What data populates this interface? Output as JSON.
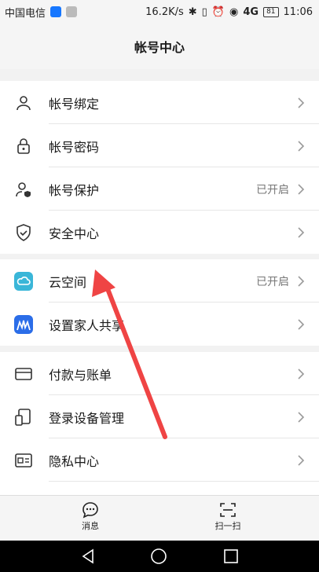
{
  "statusbar": {
    "carrier": "中国电信",
    "speed": "16.2K/s",
    "network": "4G",
    "battery": "81",
    "time": "11:06"
  },
  "header": {
    "title": "帐号中心"
  },
  "section1": [
    {
      "label": "帐号绑定",
      "status": ""
    },
    {
      "label": "帐号密码",
      "status": ""
    },
    {
      "label": "帐号保护",
      "status": "已开启"
    },
    {
      "label": "安全中心",
      "status": ""
    }
  ],
  "section2": [
    {
      "label": "云空间",
      "status": "已开启"
    },
    {
      "label": "设置家人共享",
      "status": ""
    }
  ],
  "section3": [
    {
      "label": "付款与账单",
      "status": ""
    },
    {
      "label": "登录设备管理",
      "status": ""
    },
    {
      "label": "隐私中心",
      "status": ""
    }
  ],
  "bottom_nav": {
    "messages": "消息",
    "scan": "扫一扫"
  },
  "colors": {
    "accent": "#3ab6d8",
    "arrow": "#ef4444"
  }
}
